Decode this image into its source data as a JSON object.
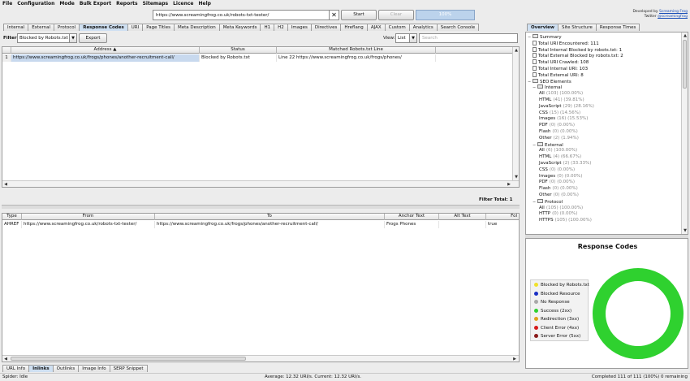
{
  "menu": [
    "File",
    "Configuration",
    "Mode",
    "Bulk Export",
    "Reports",
    "Sitemaps",
    "Licence",
    "Help"
  ],
  "toolbar": {
    "url": "https://www.screamingfrog.co.uk/robots-txt-tester/",
    "clear_glyph": "✕",
    "start_label": "Start",
    "clear_label": "Clear",
    "progress_label": "100%",
    "progress_fraction": 1.0
  },
  "developer": {
    "line1_prefix": "Developed by",
    "line1_link": "Screaming Frog",
    "line2_prefix": "Twitter",
    "line2_link": "@screamingfrog"
  },
  "main_tabs": [
    "Internal",
    "External",
    "Protocol",
    "Response Codes",
    "URI",
    "Page Titles",
    "Meta Description",
    "Meta Keywords",
    "H1",
    "H2",
    "Images",
    "Directives",
    "Hreflang",
    "AJAX",
    "Custom",
    "Analytics",
    "Search Console"
  ],
  "main_tabs_active": 3,
  "filter": {
    "label": "Filter:",
    "value": "Blocked by Robots.txt",
    "export_label": "Export",
    "view_label": "View:",
    "view_value": "List",
    "search_placeholder": "Search"
  },
  "main_table": {
    "headers": [
      "Address",
      "Status",
      "Matched Robots.txt Line"
    ],
    "sort_indicator": "▲",
    "rows": [
      {
        "index": "1",
        "address": "https://www.screamingfrog.co.uk/frogs/phones/another-recruitment-call/",
        "status": "Blocked by Robots.txt",
        "matched_line": "Line 22 https://www.screamingfrog.co.uk/frogs/phones/"
      }
    ],
    "filter_total_label": "Filter Total:",
    "filter_total_value": "1"
  },
  "lower_table": {
    "headers": [
      "Type",
      "From",
      "To",
      "Anchor Text",
      "Alt Text",
      "Fol"
    ],
    "rows": [
      {
        "type": "AHREF",
        "from": "https://www.screamingfrog.co.uk/robots-txt-tester/",
        "to": "https://www.screamingfrog.co.uk/frogs/phones/another-recruitment-call/",
        "anchor": "Frogs Phones",
        "alt": "",
        "follow": "true"
      }
    ]
  },
  "bottom_tabs": [
    "URL Info",
    "Inlinks",
    "Outlinks",
    "Image Info",
    "SERP Snippet"
  ],
  "bottom_tabs_active": 1,
  "status": {
    "left": "Spider: Idle",
    "center": "Average: 12.32 URI/s. Current: 12.32 URI/s.",
    "right": "Completed 111 of 111 (100%) 0 remaining"
  },
  "right_tabs": [
    "Overview",
    "Site Structure",
    "Response Times"
  ],
  "right_tabs_active": 0,
  "overview": [
    {
      "level": 0,
      "kind": "folder",
      "toggle": "−",
      "label": "Summary",
      "count": ""
    },
    {
      "level": 1,
      "kind": "doc",
      "label": "Total URI Encountered: 111",
      "count": ""
    },
    {
      "level": 1,
      "kind": "doc",
      "label": "Total Internal Blocked by robots.txt: 1",
      "count": ""
    },
    {
      "level": 1,
      "kind": "doc",
      "label": "Total External Blocked by robots.txt: 2",
      "count": ""
    },
    {
      "level": 1,
      "kind": "doc",
      "label": "Total URI Crawled: 108",
      "count": ""
    },
    {
      "level": 1,
      "kind": "doc",
      "label": "Total Internal URI: 103",
      "count": ""
    },
    {
      "level": 1,
      "kind": "doc",
      "label": "Total External URI: 8",
      "count": ""
    },
    {
      "level": 0,
      "kind": "folder",
      "toggle": "−",
      "label": "SEO Elements",
      "count": ""
    },
    {
      "level": 1,
      "kind": "folder",
      "toggle": "−",
      "label": "Internal",
      "count": ""
    },
    {
      "level": 2,
      "kind": "leaf",
      "label": "All",
      "count": "(103) (100.00%)"
    },
    {
      "level": 2,
      "kind": "leaf",
      "label": "HTML",
      "count": "(41) (39.81%)"
    },
    {
      "level": 2,
      "kind": "leaf",
      "label": "JavaScript",
      "count": "(29) (28.16%)"
    },
    {
      "level": 2,
      "kind": "leaf",
      "label": "CSS",
      "count": "(15) (14.56%)"
    },
    {
      "level": 2,
      "kind": "leaf",
      "label": "Images",
      "count": "(16) (15.53%)"
    },
    {
      "level": 2,
      "kind": "leaf",
      "label": "PDF",
      "count": "(0) (0.00%)"
    },
    {
      "level": 2,
      "kind": "leaf",
      "label": "Flash",
      "count": "(0) (0.00%)"
    },
    {
      "level": 2,
      "kind": "leaf",
      "label": "Other",
      "count": "(2) (1.94%)"
    },
    {
      "level": 1,
      "kind": "folder",
      "toggle": "−",
      "label": "External",
      "count": ""
    },
    {
      "level": 2,
      "kind": "leaf",
      "label": "All",
      "count": "(6) (100.00%)"
    },
    {
      "level": 2,
      "kind": "leaf",
      "label": "HTML",
      "count": "(4) (66.67%)"
    },
    {
      "level": 2,
      "kind": "leaf",
      "label": "JavaScript",
      "count": "(2) (33.33%)"
    },
    {
      "level": 2,
      "kind": "leaf",
      "label": "CSS",
      "count": "(0) (0.00%)"
    },
    {
      "level": 2,
      "kind": "leaf",
      "label": "Images",
      "count": "(0) (0.00%)"
    },
    {
      "level": 2,
      "kind": "leaf",
      "label": "PDF",
      "count": "(0) (0.00%)"
    },
    {
      "level": 2,
      "kind": "leaf",
      "label": "Flash",
      "count": "(0) (0.00%)"
    },
    {
      "level": 2,
      "kind": "leaf",
      "label": "Other",
      "count": "(0) (0.00%)"
    },
    {
      "level": 1,
      "kind": "folder",
      "toggle": "−",
      "label": "Protocol",
      "count": ""
    },
    {
      "level": 2,
      "kind": "leaf",
      "label": "All",
      "count": "(105) (100.00%)"
    },
    {
      "level": 2,
      "kind": "leaf",
      "label": "HTTP",
      "count": "(0) (0.00%)"
    },
    {
      "level": 2,
      "kind": "leaf",
      "label": "HTTPS",
      "count": "(105) (100.00%)"
    }
  ],
  "chart_data": {
    "type": "pie",
    "title": "Response Codes",
    "categories": [
      "Blocked by Robots.txt",
      "Blocked Resource",
      "No Response",
      "Success (2xx)",
      "Redirection (3xx)",
      "Client Error (4xx)",
      "Server Error (5xx)"
    ],
    "values": [
      0,
      0,
      0,
      100,
      0,
      0,
      0
    ],
    "colors": [
      "#f0e12a",
      "#1a2fc4",
      "#a9a9a9",
      "#2fd12f",
      "#e0a21a",
      "#d61a1a",
      "#8a1a1a"
    ],
    "style": "donut",
    "legend": "left"
  }
}
